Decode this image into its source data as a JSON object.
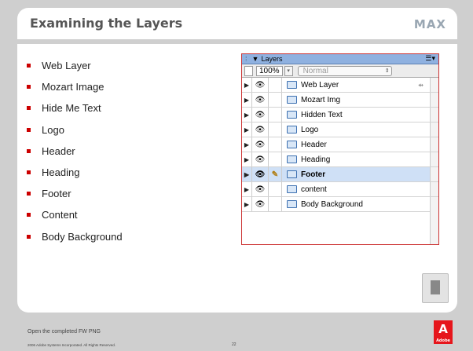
{
  "slide": {
    "title": "Examining the Layers",
    "logo_text": "MAX",
    "footer_note": "Open the completed FW PNG",
    "copyright": "2006 Adobe Systems Incorporated.  All Rights Reserved.",
    "page_number": "22",
    "brand": "Adobe",
    "brand_mark": "A"
  },
  "bullets": [
    "Web Layer",
    "Mozart Image",
    "Hide Me Text",
    "Logo",
    "Header",
    "Heading",
    "Footer",
    "Content",
    "Body Background"
  ],
  "layers_panel": {
    "title": "Layers",
    "opacity": "100%",
    "blend_mode": "Normal",
    "rows": [
      {
        "name": "Web Layer",
        "selected": false,
        "edit": "",
        "shared": true
      },
      {
        "name": "Mozart Img",
        "selected": false,
        "edit": "",
        "shared": false
      },
      {
        "name": "Hidden Text",
        "selected": false,
        "edit": "",
        "shared": false
      },
      {
        "name": "Logo",
        "selected": false,
        "edit": "",
        "shared": false
      },
      {
        "name": "Header",
        "selected": false,
        "edit": "",
        "shared": false
      },
      {
        "name": "Heading",
        "selected": false,
        "edit": "",
        "shared": false
      },
      {
        "name": "Footer",
        "selected": true,
        "edit": "✎",
        "shared": false
      },
      {
        "name": "content",
        "selected": false,
        "edit": "",
        "shared": false
      },
      {
        "name": "Body Background",
        "selected": false,
        "edit": "",
        "shared": false
      }
    ]
  },
  "icons": {
    "expand": "expand-triangle-icon",
    "eye": "eye-icon",
    "pencil": "pencil-icon",
    "folder": "folder-icon",
    "document": "document-icon"
  },
  "colors": {
    "bullet": "#cc0000",
    "panel_header": "#8fb1e0",
    "selected_row": "#cfe0f6",
    "adobe_red": "#e6161c"
  }
}
